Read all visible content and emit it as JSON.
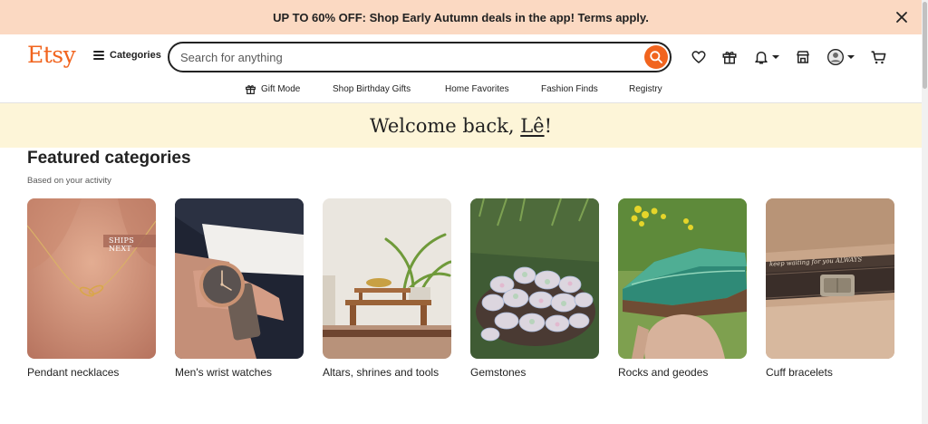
{
  "promo": {
    "text": "UP TO 60% OFF: Shop Early Autumn deals in the app! Terms apply."
  },
  "header": {
    "logo": "Etsy",
    "categories_label": "Categories",
    "search_placeholder": "Search for anything",
    "icons": [
      "heart-icon",
      "gift-icon",
      "bell-icon",
      "shop-icon",
      "avatar",
      "cart-icon"
    ]
  },
  "subnav": {
    "items": [
      {
        "label": "Gift Mode",
        "icon": "gift-icon"
      },
      {
        "label": "Shop Birthday Gifts"
      },
      {
        "label": "Home Favorites"
      },
      {
        "label": "Fashion Finds"
      },
      {
        "label": "Registry"
      }
    ]
  },
  "welcome": {
    "prefix": "Welcome back, ",
    "name": "Lê",
    "suffix": "!"
  },
  "featured": {
    "title": "Featured categories",
    "subtitle": "Based on your activity",
    "cards": [
      {
        "label": "Pendant necklaces",
        "badge": "SHIPS NEXT"
      },
      {
        "label": "Men's wrist watches"
      },
      {
        "label": "Altars, shrines and tools"
      },
      {
        "label": "Gemstones"
      },
      {
        "label": "Rocks and geodes"
      },
      {
        "label": "Cuff bracelets",
        "engraving": "keep waiting for you ALWAYS"
      }
    ]
  },
  "colors": {
    "brand": "#f1641e",
    "promo_bg": "#fbd9c2",
    "welcome_bg": "#fdf5d8"
  }
}
